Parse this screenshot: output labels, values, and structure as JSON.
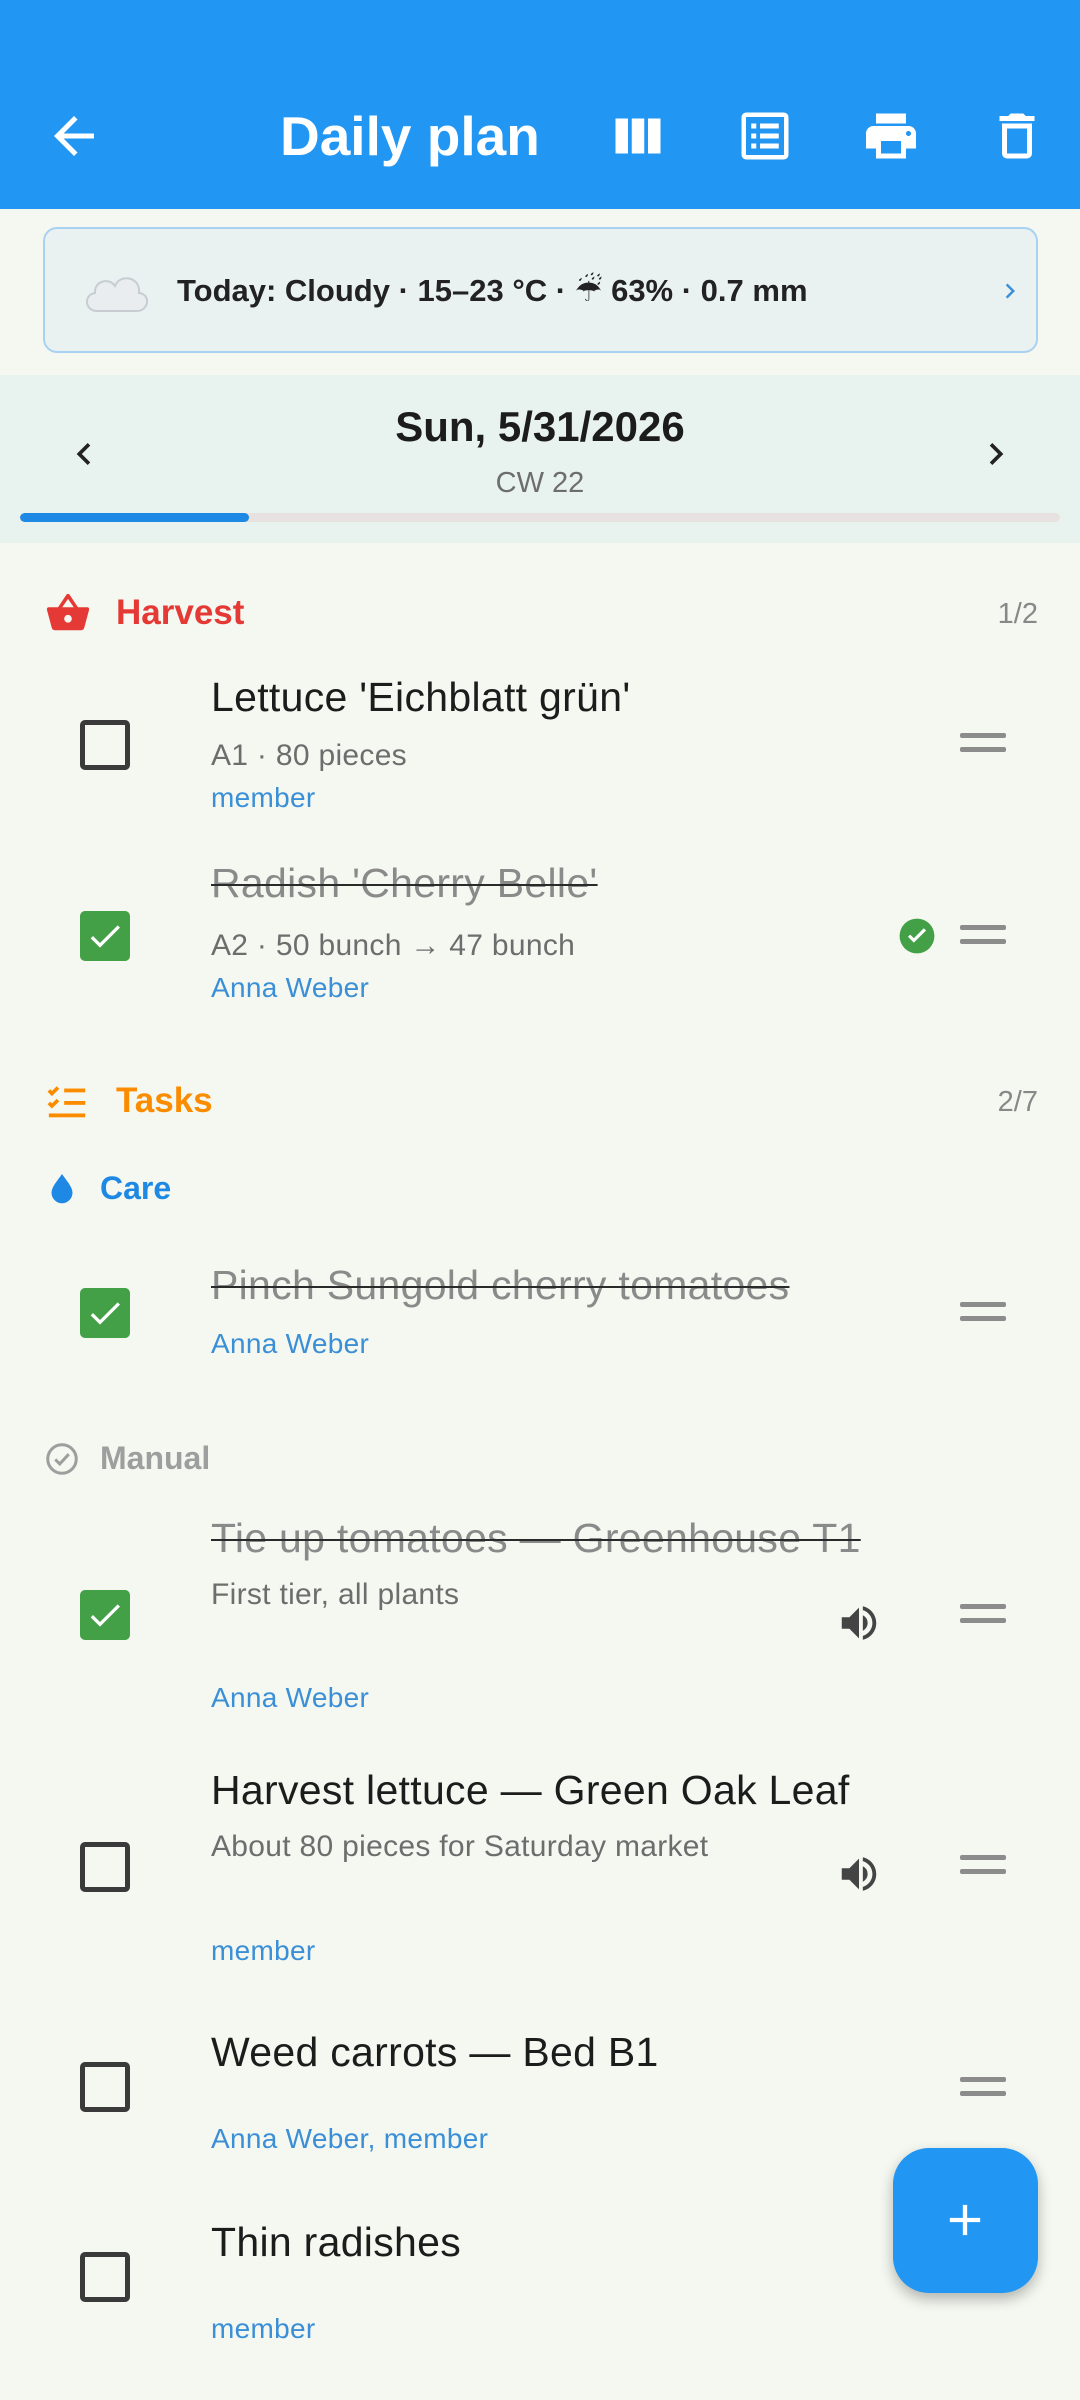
{
  "app_bar": {
    "title": "Daily plan",
    "back_icon": "arrow-back-icon",
    "actions": [
      "columns-view-icon",
      "list-view-icon",
      "print-icon",
      "delete-icon"
    ],
    "color": "#2196f3"
  },
  "weather": {
    "text": "Today: Cloudy · 15–23 °C · ☔ 63% · 0.7 mm",
    "icon": "cloud-icon"
  },
  "date_nav": {
    "date": "Sun, 5/31/2026",
    "week": "CW 22",
    "progress": 0.22
  },
  "harvest": {
    "title": "Harvest",
    "count": "1/2",
    "color": "#e53935",
    "items": [
      {
        "title": "Lettuce 'Eichblatt grün'",
        "detail": "A1 · 80 pieces",
        "assignee": "member",
        "done": false
      },
      {
        "title": "Radish 'Cherry Belle'",
        "detail": "A2 · 50 bunch → 47 bunch",
        "assignee": "Anna Weber",
        "done": true
      }
    ]
  },
  "tasks": {
    "title": "Tasks",
    "count": "2/7",
    "color": "#fb8c00",
    "care": {
      "title": "Care",
      "items": [
        {
          "title": "Pinch Sungold cherry tomatoes",
          "assignee": "Anna Weber",
          "done": true
        }
      ]
    },
    "manual": {
      "title": "Manual",
      "items": [
        {
          "title": "Tie up tomatoes — Greenhouse T1",
          "detail": "First tier, all plants",
          "assignee": "Anna Weber",
          "done": true
        },
        {
          "title": "Harvest lettuce — Green Oak Leaf",
          "detail": "About 80 pieces for Saturday market",
          "assignee": "member",
          "done": false
        },
        {
          "title": "Weed carrots — Bed B1",
          "assignee": "Anna Weber, member",
          "done": false
        },
        {
          "title": "Thin radishes",
          "assignee": "member",
          "done": false
        }
      ]
    }
  },
  "fab": {
    "icon": "add-icon"
  }
}
